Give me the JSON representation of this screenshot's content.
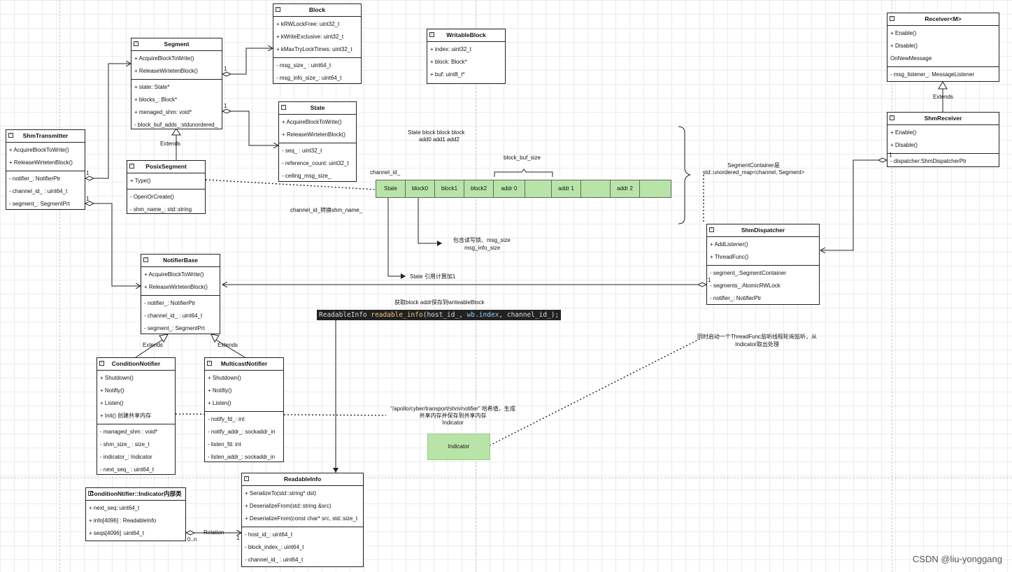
{
  "classes": {
    "block": {
      "name": "Block",
      "sections": [
        [
          "+ kRWLockFree: uint32_t",
          "+ kWriteExclusive: uint32_t",
          "+ kMaxTryLockTimes: uint32_t"
        ],
        [
          "- msg_size_ : uint64_t",
          "- msg_info_size_: uint64_t"
        ]
      ]
    },
    "writable_block": {
      "name": "WritableBlock",
      "sections": [
        [
          "+ index: uint32_t",
          "+ block: Block*",
          "+ buf: uint8_t*"
        ]
      ]
    },
    "segment": {
      "name": "Segment",
      "sections": [
        [
          "+ AcquireBlockToWrite()",
          "+ ReleaseWirtetenBlock()"
        ],
        [
          "+ state: State*",
          "+ blocks_: Block*",
          "+ menaged_shm: void*",
          "- block_buf_adds_:stdunordered_"
        ]
      ]
    },
    "state": {
      "name": "State",
      "sections": [
        [
          "+ AcquireBlockToWrite()",
          "+ ReleaseWirtetenBlock()"
        ],
        [
          "- seq_ : uint32_t",
          "- reference_count: uint32_t",
          "- ceiling_msg_size_"
        ]
      ]
    },
    "shm_transmitter": {
      "name": "ShmTransmitter",
      "sections": [
        [
          "+ AcquireBlockToWrite()",
          "+ ReleaseWirtetenBlock()"
        ],
        [
          "- notifier_: NotifierPtr",
          "- channel_id_ :  uint64_t",
          "- segment_: SegmentPrt"
        ]
      ]
    },
    "posix_segment": {
      "name": "PosixSegment",
      "sections": [
        [
          "+ Type()"
        ],
        [
          "- OpenOrCreate()",
          "- shm_name_: std::string"
        ]
      ]
    },
    "receiver": {
      "name": "Receiver<M>",
      "sections": [
        [
          "+ Enable()",
          "+ Disable()",
          "OnNewMessage"
        ],
        [
          "- msg_listener_: MessageListener"
        ]
      ]
    },
    "shm_receiver": {
      "name": "ShmReceiver",
      "sections": [
        [
          "+ Enable()",
          "+ Disable()"
        ],
        [
          "- dispatcher:ShmDispatcherPtr"
        ]
      ]
    },
    "shm_dispatcher": {
      "name": "ShmDispatcher",
      "sections": [
        [
          "+ AddListener()",
          "+ ThreadFunc()"
        ],
        [
          "- segment_:SegmentContainer",
          "- segments_:AtomicRWLock",
          "- notifier_: NotifierPtr"
        ]
      ]
    },
    "notifier_base": {
      "name": "NotifierBase",
      "sections": [
        [
          "+ AcquireBlockToWrite()",
          "+ ReleaseWirtetenBlock()"
        ],
        [
          "- notifier_: NotifierPtr",
          "- channel_id_ :  uint64_t",
          "- segment_: SegmentPrt"
        ]
      ]
    },
    "condition_notifier": {
      "name": "ConditionNotifier",
      "sections": [
        [
          "+ Shutdown()",
          "+ Notifiy()",
          "+ Listen()",
          "+ Init() 创建共享内存"
        ],
        [
          "- managed_shm : void*",
          "- shm_size_ : size_t",
          "- indicator_: Indicator",
          "- next_seq_ : uint64_t"
        ]
      ]
    },
    "multicast_notifier": {
      "name": "MulticastNotifier",
      "sections": [
        [
          "+ Shutdown()",
          "+ Notifiy()",
          "+ Listen()"
        ],
        [
          "- notify_fd_: int",
          "- notify_addr_: sockaddr_in",
          "- listen_fd: int",
          "- listen_addr_: sockaddr_in"
        ]
      ]
    },
    "readable_info": {
      "name": "ReadableInfo",
      "sections": [
        [
          "+ SerializeTo(std::string* dst)",
          "+ DeserializeFrom(std::string &src)",
          "+ DeserializeFrom(const char* src, std::size_t"
        ],
        [
          "- host_id_: uint64_t",
          "- block_index_: uint64_t",
          "- channel_id_ :  uint64_t"
        ]
      ]
    },
    "indicator_inner": {
      "name": "ConditionNtifier::Indicator内部类",
      "sections": [
        [
          "+ next_seq: uint64_t",
          "+ info[4096] : ReadableInfo",
          "+ seqs[4096] :uint64_t"
        ]
      ]
    }
  },
  "memory_layout": {
    "cells": [
      "State",
      "block0",
      "block1",
      "block2",
      "addr 0",
      "",
      "addr 1",
      "",
      "addr 2",
      ""
    ]
  },
  "labels": {
    "extends": "Extends",
    "relation": "Relation",
    "mult_1": "1",
    "mult_0n": "0..n",
    "state_block_line1": "State block      block block",
    "state_block_line2": "add0  add1 add2",
    "block_buf_size": "block_buf_size",
    "channel_id": "channel_id_",
    "channel_id_to_shm": "channel_id_转换shm_name_",
    "contains_rw_line1": "包含读写锁、msg_size",
    "contains_rw_line2": "msg_info_size",
    "state_refcount": "State 引用计算加1",
    "segment_container_line1": "SegmentContainer是",
    "segment_container_line2": "std::unordered_map<channel, Segment>",
    "get_block_addr": "获取block  addr保存到writeableBlock",
    "code_type": "ReadableInfo ",
    "code_var": "readable_info",
    "code_args_a": "(host_id_, ",
    "code_wb": "wb.index",
    "code_args_b": ", channel_id_);",
    "threadfunc_line1": "同时启动一个ThreadFunc监听线程轮询监听，从",
    "threadfunc_line2": "Indicator取出处理",
    "hash_line1": "\"/apollo/cyber/transport/shm/notifier\" 哈希值，生成",
    "hash_line2": "共享内存并保存到共享内存",
    "hash_line3": "Indicator",
    "indicator": "Indicator",
    "watermark": "CSDN @liu-yonggang"
  }
}
